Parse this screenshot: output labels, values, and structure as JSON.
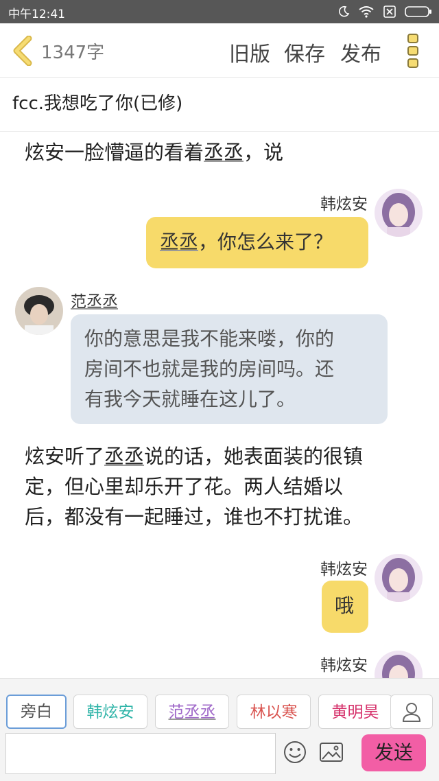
{
  "status_bar": {
    "time": "中午12:41"
  },
  "header": {
    "word_count": "1347字",
    "actions": [
      "旧版",
      "保存",
      "发布"
    ]
  },
  "story_title": "fcc.我想吃了你(已修)",
  "content": {
    "narration1": {
      "before": "炫安一脸懵逼的看着",
      "name": "丞丞",
      "after": "，说"
    },
    "msg1": {
      "speaker": "韩炫安",
      "name": "丞丞",
      "text": "，你怎么来了？"
    },
    "msg2": {
      "speaker": "范丞丞",
      "lines": [
        "你的意思是我不能来喽，你的",
        "房间不也就是我的房间吗。还",
        "有我今天就睡在这儿了。"
      ]
    },
    "narration2": {
      "line1_before": "炫安听了",
      "line1_name": "丞丞",
      "line1_after": "说的话，她表面装的很镇",
      "line2": "定，但心里却乐开了花。两人结婚以",
      "line3": "后，都没有一起睡过，谁也不打扰谁。"
    },
    "msg3": {
      "speaker": "韩炫安",
      "text": "哦"
    },
    "msg4": {
      "speaker": "韩炫安"
    }
  },
  "characters": [
    {
      "label": "旁白",
      "color": "#555555"
    },
    {
      "label": "韩炫安",
      "color": "#2fb4a8"
    },
    {
      "label": "范丞丞",
      "color": "#a069c9"
    },
    {
      "label": "林以寒",
      "color": "#d9534f"
    },
    {
      "label": "黄明昊",
      "color": "#d6336c"
    }
  ],
  "input": {
    "placeholder": "",
    "send_label": "发送"
  }
}
